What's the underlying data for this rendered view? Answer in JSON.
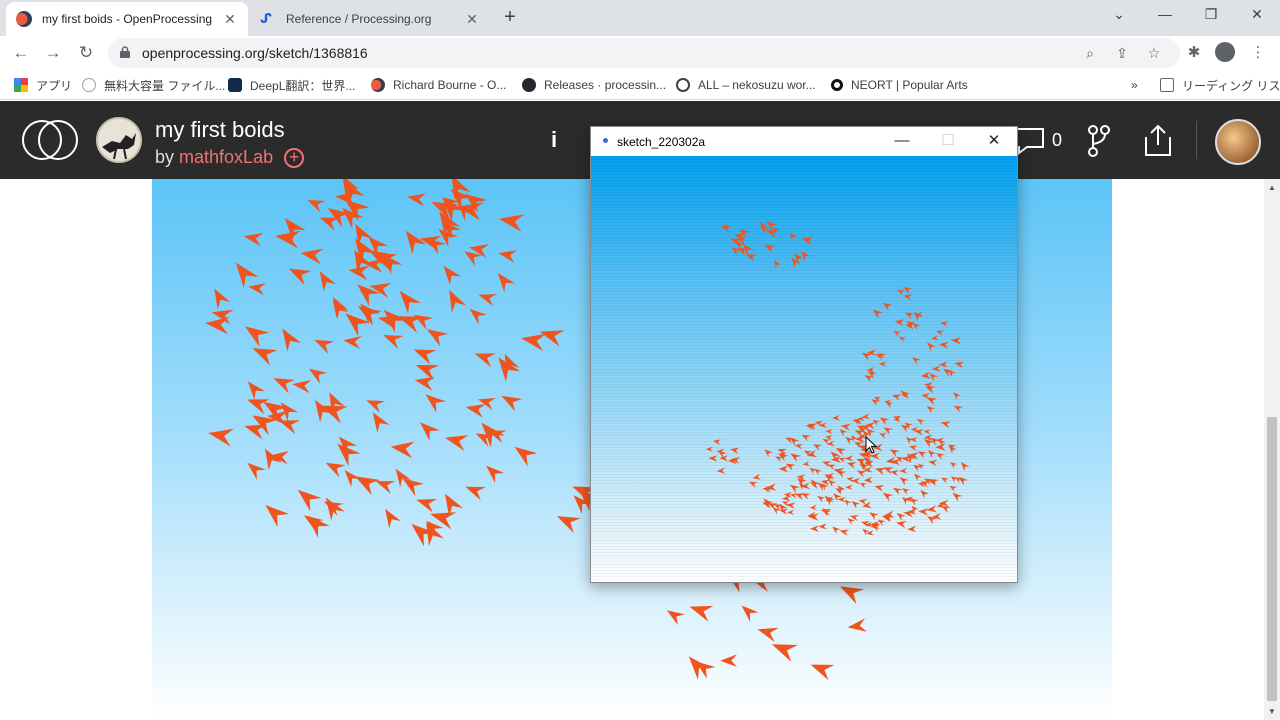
{
  "browser": {
    "tabs": [
      {
        "title": "my first boids - OpenProcessing",
        "active": true
      },
      {
        "title": "Reference / Processing.org",
        "active": false
      }
    ],
    "url": "openprocessing.org/sketch/1368816",
    "bookmarks": [
      {
        "label": "アプリ"
      },
      {
        "label": "無料大容量 ファイル..."
      },
      {
        "label": "DeepL翻訳：世界..."
      },
      {
        "label": "Richard Bourne - O..."
      },
      {
        "label": "Releases · processin..."
      },
      {
        "label": "ALL – nekosuzu wor..."
      },
      {
        "label": "NEORT | Popular Arts"
      }
    ],
    "overflow_label": "»",
    "reading_list": "リーディング リスト"
  },
  "sketch": {
    "title": "my first boids",
    "by_prefix": "by",
    "author": "mathfoxLab",
    "info_label": "i",
    "comment_count": "0"
  },
  "processing_window": {
    "title": "sketch_220302a"
  },
  "colors": {
    "header_bg": "#2b2b2b",
    "author_accent": "#f1726f",
    "boid_color": "#f0541e",
    "sky_top": "#5cc4f7"
  }
}
